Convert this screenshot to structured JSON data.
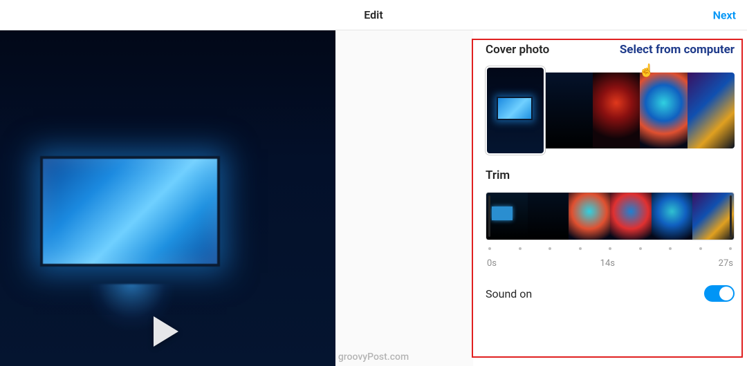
{
  "header": {
    "title": "Edit",
    "next_label": "Next"
  },
  "preview": {
    "watermark": "groovyPost.com"
  },
  "cover": {
    "label": "Cover photo",
    "select_link": "Select from computer"
  },
  "trim": {
    "label": "Trim",
    "tick_labels": {
      "start": "0s",
      "mid": "14s",
      "end": "27s"
    }
  },
  "sound": {
    "label": "Sound on",
    "enabled": true
  },
  "colors": {
    "accent": "#0095f6",
    "annotation": "#e02020"
  }
}
